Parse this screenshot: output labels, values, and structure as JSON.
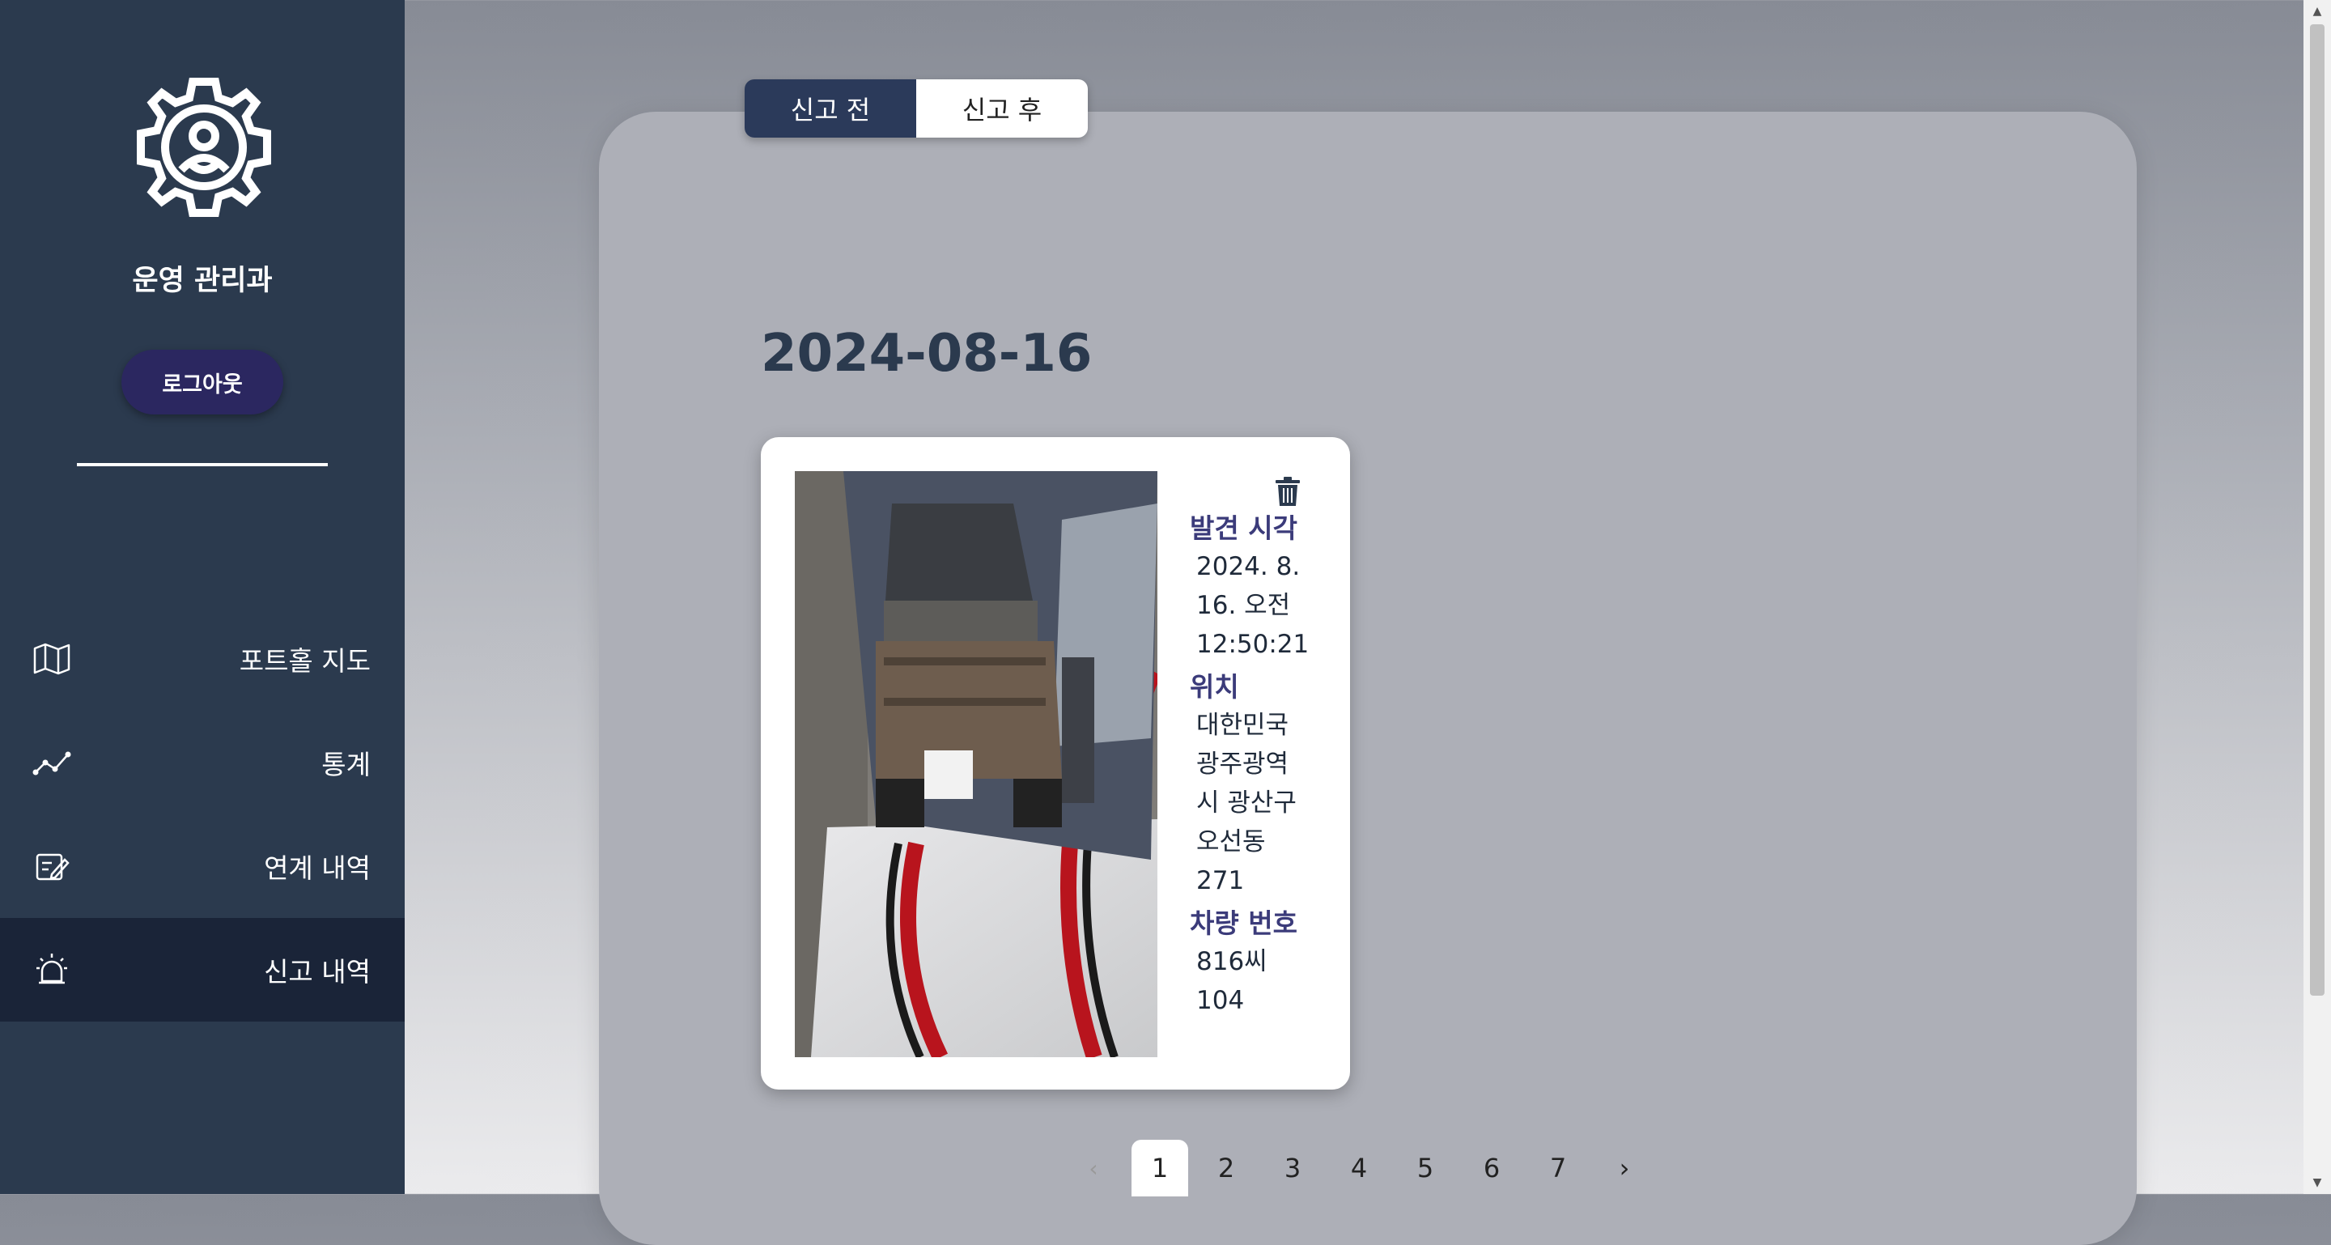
{
  "sidebar": {
    "department": "운영 관리과",
    "logout_label": "로그아웃",
    "items": [
      {
        "label": "포트홀 지도",
        "icon": "map-icon"
      },
      {
        "label": "통계",
        "icon": "chart-line-icon"
      },
      {
        "label": "연계 내역",
        "icon": "edit-note-icon"
      },
      {
        "label": "신고 내역",
        "icon": "siren-icon",
        "active": true
      }
    ]
  },
  "tabs": [
    {
      "label": "신고 전",
      "active": true
    },
    {
      "label": "신고 후",
      "active": false
    }
  ],
  "main": {
    "date": "2024-08-16",
    "report": {
      "found_time_label": "발견 시각",
      "found_time_value": "2024. 8.\n16. 오전\n12:50:21",
      "location_label": "위치",
      "location_value": "대한민국\n광주광역\n시 광산구\n오선동\n271",
      "plate_label": "차량 번호",
      "plate_value": "816씨\n104"
    }
  },
  "pagination": {
    "prev": "‹",
    "next": "›",
    "pages": [
      "1",
      "2",
      "3",
      "4",
      "5",
      "6",
      "7"
    ],
    "current": "1"
  },
  "colors": {
    "sidebar_bg": "#2b3a4e",
    "active_nav_bg": "#1a2438",
    "logout_bg": "#2b2760",
    "heading": "#2b3a4e",
    "label": "#3b3b7a"
  }
}
